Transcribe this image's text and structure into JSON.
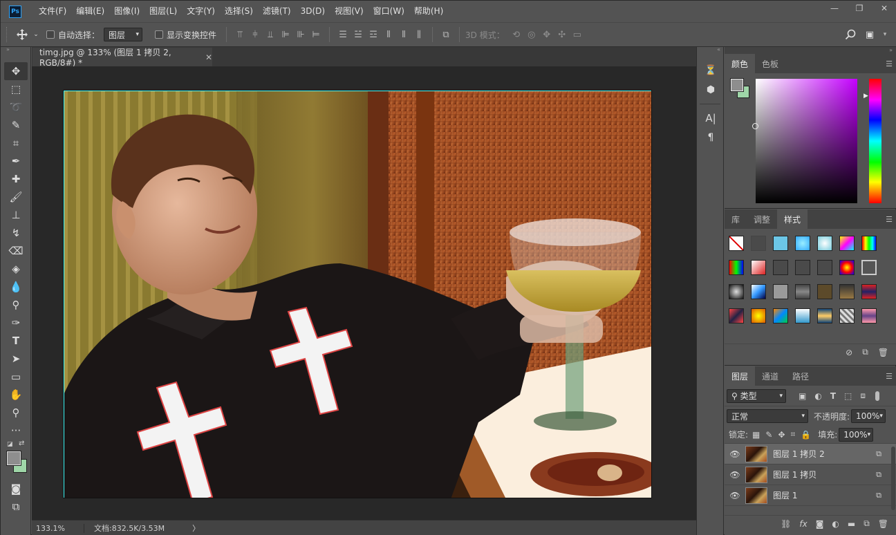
{
  "app": {
    "logo": "Ps"
  },
  "menu": [
    "文件(F)",
    "编辑(E)",
    "图像(I)",
    "图层(L)",
    "文字(Y)",
    "选择(S)",
    "滤镜(T)",
    "3D(D)",
    "视图(V)",
    "窗口(W)",
    "帮助(H)"
  ],
  "window_controls": {
    "minimize": "—",
    "restore": "❐",
    "close": "✕"
  },
  "options": {
    "auto_select_label": "自动选择：",
    "auto_select_target": "图层",
    "show_transform_label": "显示变换控件",
    "mode_3d_label": "3D 模式："
  },
  "document": {
    "tab_title": "timg.jpg @ 133% (图层 1 拷贝 2, RGB/8#) *",
    "zoom": "133.1%",
    "doc_info": "文档:832.5K/3.53M",
    "status_arrow": "〉"
  },
  "color_panel": {
    "tabs": [
      "颜色",
      "色板"
    ],
    "fg": "#8e8e8e",
    "bg": "#9fd6a8"
  },
  "styles_panel": {
    "tabs": [
      "库",
      "调整",
      "样式"
    ]
  },
  "layers_panel": {
    "tabs": [
      "图层",
      "通道",
      "路径"
    ],
    "filter_label": "类型",
    "blend_mode": "正常",
    "opacity_label": "不透明度:",
    "opacity_value": "100%",
    "lock_label": "锁定:",
    "fill_label": "填充:",
    "fill_value": "100%",
    "layers": [
      {
        "name": "图层 1 拷贝 2",
        "selected": true
      },
      {
        "name": "图层 1 拷贝",
        "selected": false
      },
      {
        "name": "图层 1",
        "selected": false
      }
    ]
  },
  "toolbar_icons": [
    "move-icon",
    "marquee-icon",
    "lasso-icon",
    "quick-select-icon",
    "crop-icon",
    "eyedropper-icon",
    "healing-brush-icon",
    "brush-icon",
    "clone-stamp-icon",
    "history-brush-icon",
    "eraser-icon",
    "paint-bucket-icon",
    "blur-icon",
    "dodge-icon",
    "pen-icon",
    "type-icon",
    "path-select-icon",
    "rectangle-icon",
    "hand-icon",
    "zoom-icon",
    "more-icon"
  ],
  "dock_icons": [
    "history-icon",
    "3d-icon",
    "character-icon",
    "paragraph-icon"
  ]
}
